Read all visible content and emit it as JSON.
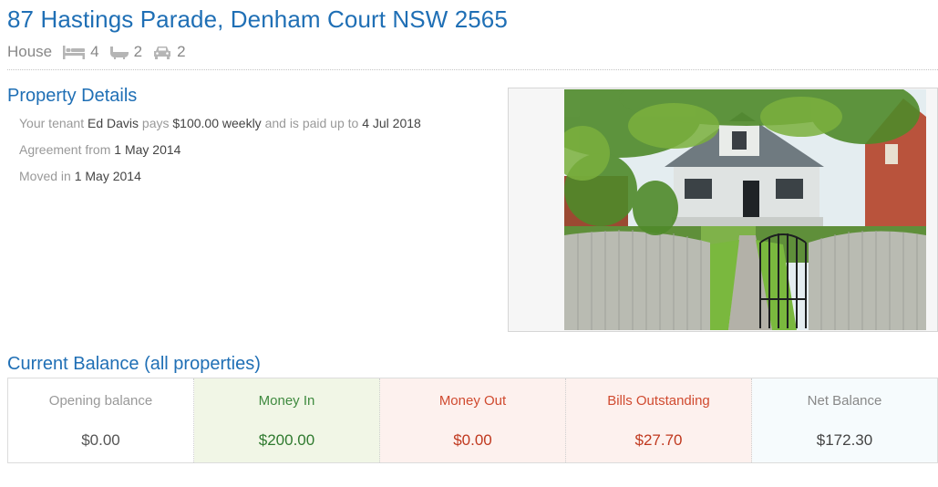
{
  "property": {
    "address": "87 Hastings Parade, Denham Court NSW 2565",
    "type": "House",
    "features": [
      {
        "icon": "bed-icon",
        "count": "4"
      },
      {
        "icon": "bath-icon",
        "count": "2"
      },
      {
        "icon": "car-icon",
        "count": "2"
      }
    ]
  },
  "details": {
    "title": "Property Details",
    "line1": {
      "prefix": "Your tenant",
      "tenant": "Ed Davis",
      "mid": "pays",
      "rent": "$100.00 weekly",
      "paid_label": "and is paid up to",
      "paid_date": "4 Jul 2018"
    },
    "line2": {
      "label": "Agreement from",
      "date": "1 May 2014"
    },
    "line3": {
      "label": "Moved in",
      "date": "1 May 2014"
    }
  },
  "photo": {
    "alt": "house-photo"
  },
  "balance": {
    "title": "Current Balance (all properties)",
    "cells": [
      {
        "label": "Opening balance",
        "amount": "$0.00"
      },
      {
        "label": "Money In",
        "amount": "$200.00"
      },
      {
        "label": "Money Out",
        "amount": "$0.00"
      },
      {
        "label": "Bills Outstanding",
        "amount": "$27.70"
      },
      {
        "label": "Net Balance",
        "amount": "$172.30"
      }
    ]
  },
  "colors": {
    "heading": "#1f6fb5",
    "money_in": "#2f7a2f",
    "money_out": "#c0391f",
    "money_in_bg": "#f1f6e6",
    "money_out_bg": "#fdf1ee"
  }
}
